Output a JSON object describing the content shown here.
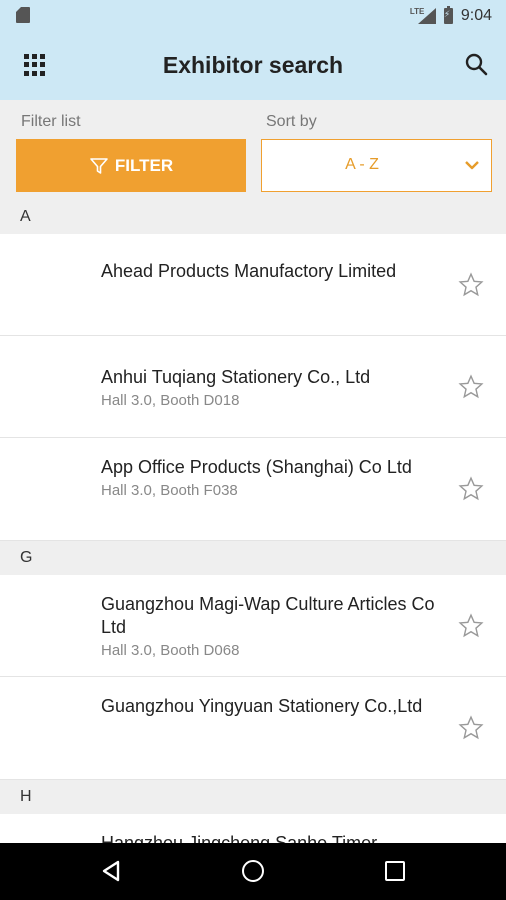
{
  "status_bar": {
    "network": "LTE",
    "time": "9:04"
  },
  "app_bar": {
    "title": "Exhibitor search",
    "menu_icon": "grid-menu-icon",
    "search_icon": "search-icon"
  },
  "controls": {
    "filter_label": "Filter list",
    "filter_button": "FILTER",
    "sort_label": "Sort by",
    "sort_value": "A - Z"
  },
  "sections": [
    {
      "letter": "A",
      "exhibitors": [
        {
          "name": "Ahead Products Manufactory Limited",
          "booth": ""
        },
        {
          "name": "Anhui Tuqiang Stationery Co., Ltd",
          "booth": "Hall 3.0, Booth D018"
        },
        {
          "name": "App Office Products (Shanghai) Co Ltd",
          "booth": "Hall 3.0, Booth F038"
        }
      ]
    },
    {
      "letter": "G",
      "exhibitors": [
        {
          "name": "Guangzhou Magi-Wap Culture Articles Co Ltd",
          "booth": "Hall 3.0, Booth D068"
        },
        {
          "name": "Guangzhou Yingyuan Stationery Co.,Ltd",
          "booth": ""
        }
      ]
    },
    {
      "letter": "H",
      "exhibitors": [
        {
          "name": "Hangzhou Jingcheng Sanhe Timer",
          "booth": ""
        }
      ]
    }
  ],
  "colors": {
    "accent": "#f0a030",
    "header_bg": "#cde8f5",
    "section_bg": "#efefef"
  }
}
